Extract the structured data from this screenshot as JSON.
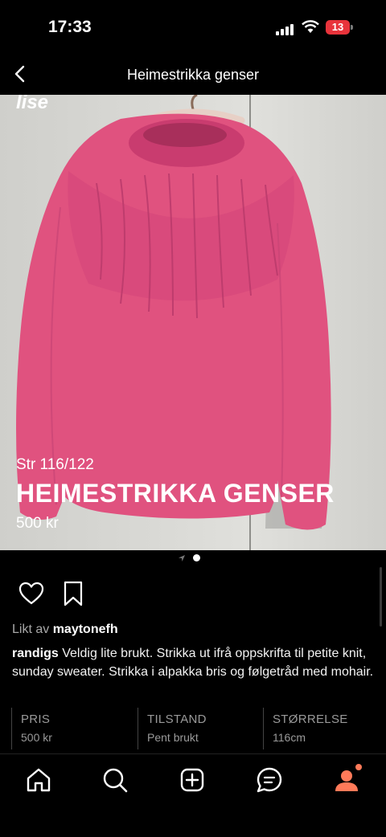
{
  "status_bar": {
    "time": "17:33",
    "battery": "13"
  },
  "header": {
    "title": "Heimestrikka genser"
  },
  "photo": {
    "logo": "lise",
    "size_text": "Str 116/122",
    "name_text": "HEIMESTRIKKA GENSER",
    "price_text": "500 kr",
    "sweater_color": "#e0527f"
  },
  "pager": {
    "pages": 2,
    "current": 2
  },
  "likes": {
    "prefix": "Likt av ",
    "user": "maytonefh"
  },
  "caption": {
    "user": "randigs",
    "text": " Veldig lite brukt. Strikka ut ifrå oppskrifta til petite knit, sunday sweater. Strikka i alpakka bris og følgetråd med mohair."
  },
  "details": [
    {
      "label": "PRIS",
      "value": "500 kr"
    },
    {
      "label": "TILSTAND",
      "value": "Pent brukt"
    },
    {
      "label": "STØRRELSE",
      "value": "116cm"
    }
  ],
  "tabs": [
    "home-icon",
    "search-icon",
    "add-icon",
    "messages-icon",
    "profile-icon"
  ],
  "colors": {
    "accent": "#ff7a59",
    "notification_dot": "#ff7a59"
  }
}
